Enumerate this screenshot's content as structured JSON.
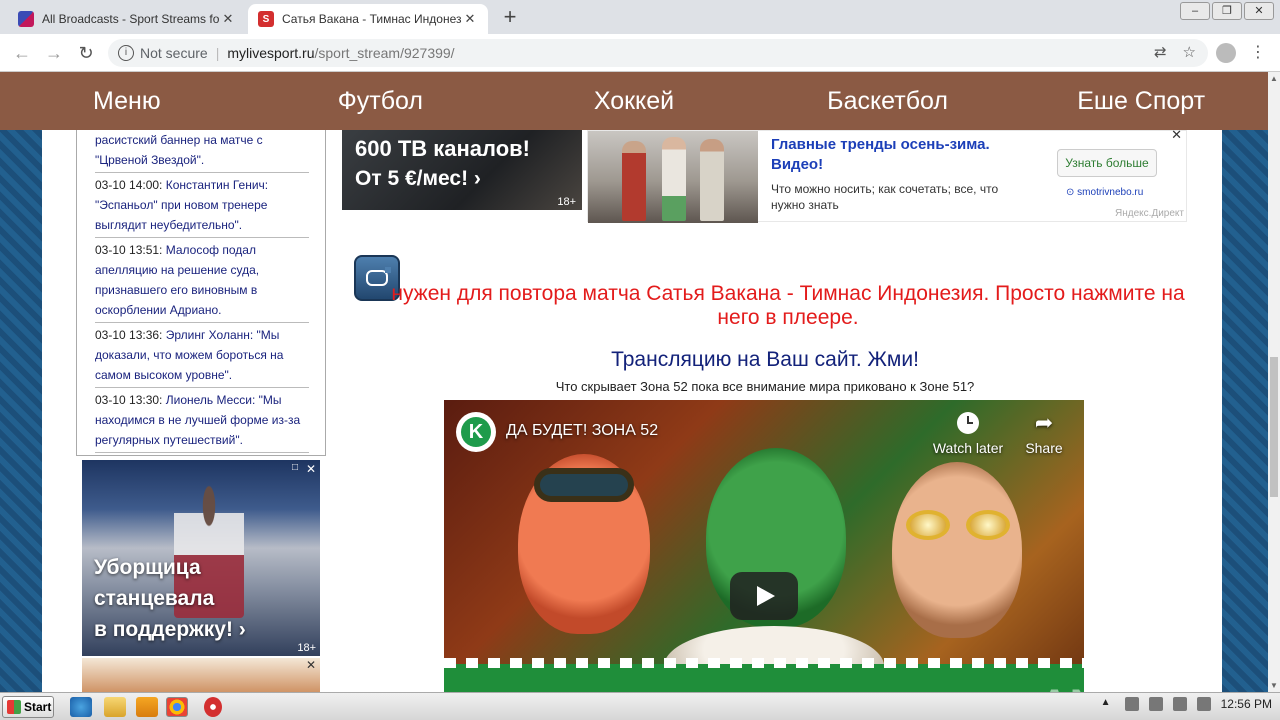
{
  "browser": {
    "tabs": [
      {
        "title": "All Broadcasts - Sport Streams for ea",
        "active": false
      },
      {
        "title": "Сатья Вакана - Тимнас Индонезия",
        "active": true
      }
    ],
    "address": {
      "security_label": "Not secure",
      "host": "mylivesport.ru",
      "path": "/sport_stream/927399/"
    }
  },
  "site_nav": [
    "Меню",
    "Футбол",
    "Хоккей",
    "Баскетбол",
    "Еше Спорт"
  ],
  "news": [
    {
      "time": "",
      "text": "расистский баннер на матче с \"Црвеной Звездой\"."
    },
    {
      "time": "03-10 14:00:",
      "text": "Константин Генич: \"Эспаньол\" при новом тренере выглядит неубедительно\"."
    },
    {
      "time": "03-10 13:51:",
      "text": "Малософ подал апелляцию на решение суда, признавшего его виновным в оскорблении Адриано."
    },
    {
      "time": "03-10 13:36:",
      "text": "Эрлинг Холанн: \"Мы доказали, что можем бороться на самом высоком уровне\"."
    },
    {
      "time": "03-10 13:30:",
      "text": "Лионель Месси: \"Мы находимся в не лучшей форме из-за регулярных путешествий\"."
    }
  ],
  "ads": {
    "tv": {
      "line1": "600 ТВ каналов!",
      "line2": "От 5 €/мес! ›",
      "age": "18+"
    },
    "yandex": {
      "headline": "Главные тренды осень-зима. Видео!",
      "description": "Что можно носить; как сочетать; все, что нужно знать",
      "cta": "Узнать больше",
      "domain": "smotrivnebo.ru",
      "label": "Яндекс.Директ"
    },
    "left": {
      "caption": [
        "Уборщица",
        "станцевала",
        "в поддержку! ›"
      ],
      "age": "18+"
    }
  },
  "stream": {
    "message": "нужен для повтора матча Сатья Вакана - Тимнас Индонезия. Просто нажмите на него в плеере.",
    "embed_link": "Трансляцию на Ваш сайт. Жми!",
    "video_question": "Что скрывает Зона 52 пока все внимание мира приковано к Зоне 51?"
  },
  "video": {
    "channel_initial": "K",
    "title": "ДА БУДЕТ! ЗОНА 52",
    "watch_later": "Watch later",
    "share": "Share"
  },
  "watermark": "ANY.RUN",
  "taskbar": {
    "start_label": "Start",
    "clock": "12:56 PM"
  }
}
